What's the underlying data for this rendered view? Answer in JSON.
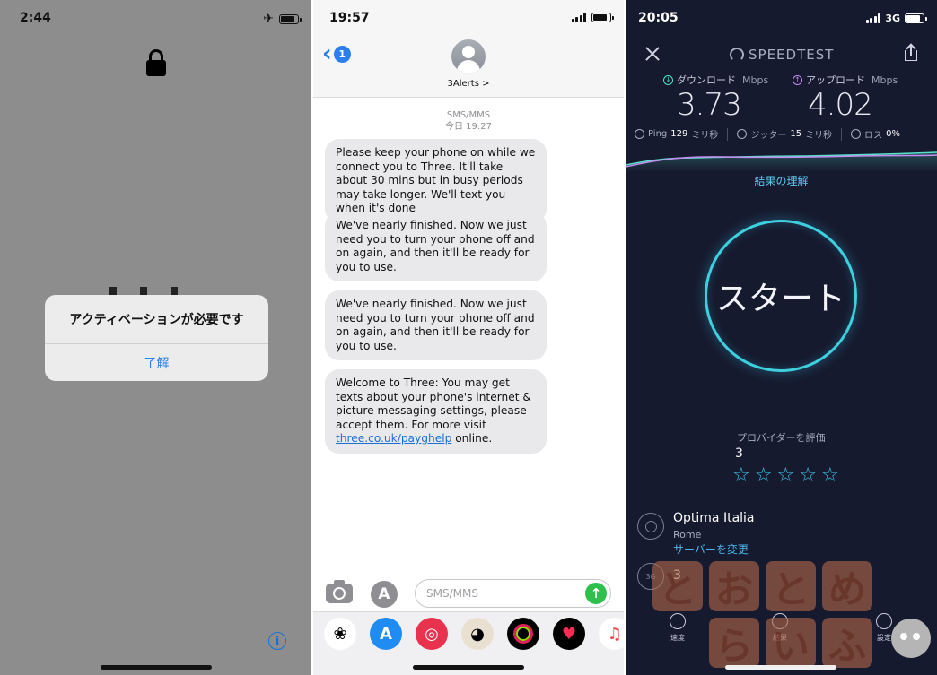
{
  "panel1": {
    "status_time": "2:44",
    "alert_title": "アクティベーションが必要です",
    "alert_button": "了解",
    "info_glyph": "i"
  },
  "panel2": {
    "status_time": "19:57",
    "back_badge": "1",
    "contact_name": "3Alerts >",
    "meta_type": "SMS/MMS",
    "meta_time": "今日 19:27",
    "messages": [
      "Please keep your phone on while we connect you to Three. It'll take about 30 mins but in busy periods may take longer. We'll text you when it's done",
      "We've nearly finished. Now we just need you to turn your phone off and on again, and then it'll be ready for you to use.",
      "We've nearly finished. Now we just need you to turn your phone off and on again, and then it'll be ready for you to use.",
      {
        "before": "Welcome to Three: You may get texts about your phone's internet & picture messaging settings, please accept them. For more visit ",
        "link": "three.co.uk/payghelp",
        "after": " online."
      }
    ],
    "input_placeholder": "SMS/MMS",
    "send_glyph": "↑",
    "drawer_icons": [
      "photos-icon",
      "appstore-icon",
      "search-images-icon",
      "animoji-icon",
      "activity-icon",
      "digital-touch-icon",
      "music-icon"
    ],
    "accent": "#2a7ef0"
  },
  "panel3": {
    "status_time": "20:05",
    "network": "3G",
    "brand": "SPEEDTEST",
    "download_label": "ダウンロード",
    "upload_label": "アップロード",
    "unit": "Mbps",
    "download_value": "3.73",
    "upload_value": "4.02",
    "ping_label": "Ping",
    "ping_value": "129",
    "ping_unit": "ミリ秒",
    "jitter_label": "ジッター",
    "jitter_value": "15",
    "jitter_unit": "ミリ秒",
    "loss_label": "ロス",
    "loss_value": "0%",
    "results_link": "結果の理解",
    "go_label": "スタート",
    "rate_label": "プロバイダーを評価",
    "rate_provider": "3",
    "rating_stars": 5,
    "server_name": "Optima Italia",
    "server_city": "Rome",
    "change_server": "サーバーを変更",
    "carrier_icon_text": "3G",
    "carrier_name": "3",
    "tab_speed": "速度",
    "tab_results": "結果",
    "tab_settings": "設定",
    "watermark": [
      "と",
      "お",
      "と",
      "め",
      "ら",
      "い",
      "ふ"
    ],
    "accent": "#3fd0e0"
  }
}
